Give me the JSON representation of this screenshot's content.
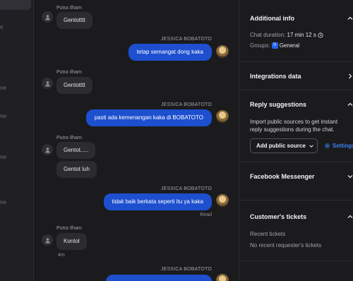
{
  "left_rail": {
    "fragments": [
      "e",
      "ne",
      "ne",
      "ne",
      "ne"
    ]
  },
  "chat": {
    "messages": [
      {
        "from": "user",
        "sender": "Putra Ilham",
        "text": "Gentotttt"
      },
      {
        "from": "agent",
        "sender": "JESSICA BOBATOTO",
        "text": "tetap semangat dong kaka"
      },
      {
        "from": "user",
        "sender": "Putra Ilham",
        "text": "Gentotttt"
      },
      {
        "from": "agent",
        "sender": "JESSICA BOBATOTO",
        "text": "pasti ada kemenangan kaka di BOBATOTO"
      },
      {
        "from": "user",
        "sender": "Putra Ilham",
        "texts": [
          "Gentot.....",
          "Gentot luh"
        ]
      },
      {
        "from": "agent",
        "sender": "JESSICA BOBATOTO",
        "text": "tidak baik berkata seperti itu ya kaka",
        "status": "Read"
      },
      {
        "from": "user",
        "sender": "Putra Ilham",
        "text": "Kontol",
        "time": "4m"
      },
      {
        "from": "agent",
        "sender": "JESSICA BOBATOTO",
        "text": ""
      }
    ]
  },
  "panel": {
    "additional_info": {
      "title": "Additional info",
      "duration_label": "Chat duration:",
      "duration_value": "17 min 12 s",
      "groups_label": "Groups:",
      "group_badge": "0",
      "group_name": "General"
    },
    "integrations": {
      "title": "Integrations data"
    },
    "reply_suggestions": {
      "title": "Reply suggestions",
      "description_line1": "Import public sources to get instant",
      "description_line2": "reply suggestions during the chat.",
      "add_button": "Add public source",
      "settings_link": "Settings"
    },
    "facebook": {
      "title": "Facebook Messenger"
    },
    "tickets": {
      "title": "Customer's tickets",
      "recent_label": "Recent tickets",
      "empty_label": "No recent requester's tickets"
    }
  },
  "colors": {
    "accent": "#1d4fcf",
    "link": "#3b82f6",
    "background": "#1b1b1e"
  }
}
